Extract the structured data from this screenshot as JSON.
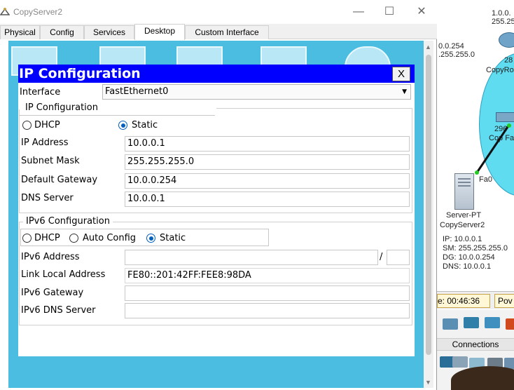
{
  "window": {
    "title": "CopyServer2",
    "controls": {
      "minimize": "—",
      "maximize": "☐",
      "close": "✕"
    }
  },
  "tabs": [
    {
      "label": "Physical"
    },
    {
      "label": "Config"
    },
    {
      "label": "Services"
    },
    {
      "label": "Desktop",
      "active": true
    },
    {
      "label": "Custom Interface"
    }
  ],
  "ip_config": {
    "title": "IP Configuration",
    "close_label": "X",
    "interface_label": "Interface",
    "interface_value": "FastEthernet0",
    "ipv4_group_title": "IP Configuration",
    "dhcp_label": "DHCP",
    "static_label": "Static",
    "mode": "Static",
    "ip_address_label": "IP Address",
    "ip_address": "10.0.0.1",
    "subnet_mask_label": "Subnet Mask",
    "subnet_mask": "255.255.255.0",
    "default_gateway_label": "Default Gateway",
    "default_gateway": "10.0.0.254",
    "dns_server_label": "DNS Server",
    "dns_server": "10.0.0.1",
    "ipv6_group_title": "IPv6 Configuration",
    "ipv6_dhcp_label": "DHCP",
    "ipv6_auto_label": "Auto Config",
    "ipv6_static_label": "Static",
    "ipv6_mode": "Static",
    "ipv6_address_label": "IPv6 Address",
    "ipv6_address": "",
    "ipv6_prefix_sep": "/",
    "ipv6_prefix": "",
    "link_local_label": "Link Local Address",
    "link_local": "FE80::201:42FF:FEE8:98DA",
    "ipv6_gateway_label": "IPv6 Gateway",
    "ipv6_gateway": "",
    "ipv6_dns_label": "IPv6 DNS Server",
    "ipv6_dns": ""
  },
  "workspace": {
    "top_net_1": "1.0.0.",
    "top_net_2": "255.25",
    "left_addr_1": "0.0.254",
    "left_addr_2": ".255.255.0",
    "router_label_1": "28",
    "router_label_2": "CopyRo",
    "switch_label_1": "296",
    "switch_label_2": "Cop Fa",
    "port_label": "Fa0",
    "server_label_1": "Server-PT",
    "server_label_2": "CopyServer2",
    "server_ip": "IP: 10.0.0.1",
    "server_sm": "SM: 255.255.255.0",
    "server_dg": "DG: 10.0.0.254",
    "server_dns": "DNS: 10.0.0.1",
    "time_label": "e: 00:46:36",
    "power_label": "Pov",
    "connections_label": "Connections"
  },
  "colors": {
    "desktop_bg": "#4bbde0",
    "ip_header_bg": "#0000ff",
    "radio_selected": "#0060c0",
    "link_green": "#22cc22"
  }
}
